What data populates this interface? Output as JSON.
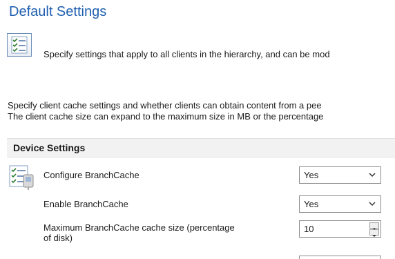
{
  "page": {
    "title": "Default Settings",
    "intro_text": "Specify settings that apply to all clients in the hierarchy, and can be mod",
    "description_lines": [
      "Specify client cache settings and whether clients can obtain content from a pee",
      "The client cache size can expand to the maximum size in MB or the percentage"
    ]
  },
  "section": {
    "title": "Device Settings",
    "settings": [
      {
        "label": "Configure BranchCache",
        "value": "Yes",
        "icon": "settings-list-icon"
      },
      {
        "label": "Enable BranchCache",
        "value": "Yes"
      },
      {
        "label_lines": [
          "Maximum BranchCache cache size (percentage",
          "of disk)"
        ],
        "value": "10"
      }
    ]
  },
  "icons": {
    "intro": "settings-list-icon",
    "dropdown": "chevron-down-icon",
    "spin_up": "spin-up-icon",
    "spin_down": "spin-down-icon"
  },
  "colors": {
    "title": "#1f5fb0",
    "section_header_bg": "#f2f2f2",
    "control_border": "#8a8a8a"
  }
}
